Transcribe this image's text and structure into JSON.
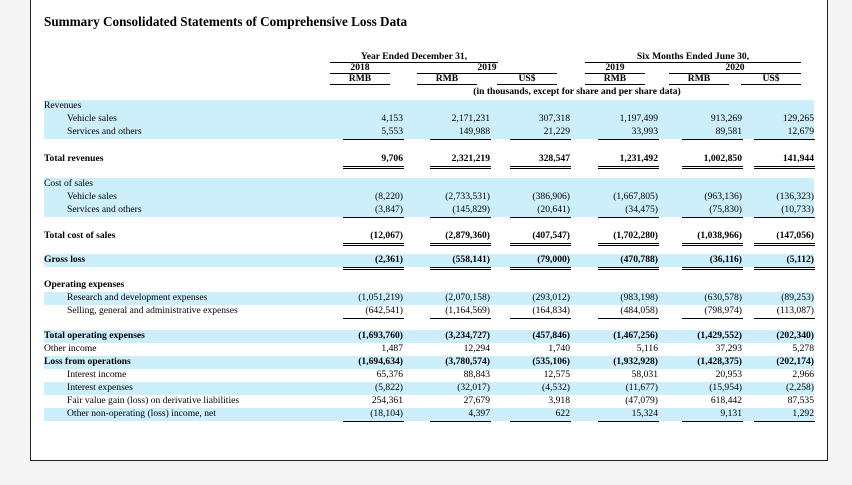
{
  "title": "Summary Consolidated Statements of Comprehensive Loss Data",
  "header": {
    "group1": "Year Ended December 31,",
    "group2": "Six Months Ended June 30,",
    "year2018": "2018",
    "year2019a": "2019",
    "year2019b": "2019",
    "year2020": "2020",
    "cur": [
      "RMB",
      "RMB",
      "US$",
      "RMB",
      "RMB",
      "US$"
    ],
    "note": "(in thousands, except for share and per share data)"
  },
  "rows": [
    {
      "label": "Revenues",
      "values": []
    },
    {
      "label": "Vehicle sales",
      "values": [
        "4,153",
        "2,171,231",
        "307,318",
        "1,197,499",
        "913,269",
        "129,265"
      ]
    },
    {
      "label": "Services and others",
      "values": [
        "5,553",
        "149,988",
        "21,229",
        "33,993",
        "89,581",
        "12,679"
      ]
    },
    {
      "label": "Total revenues",
      "values": [
        "9,706",
        "2,321,219",
        "328,547",
        "1,231,492",
        "1,002,850",
        "141,944"
      ]
    },
    {
      "label": "Cost of sales",
      "values": []
    },
    {
      "label": "Vehicle sales",
      "values": [
        "(8,220)",
        "(2,733,531)",
        "(386,906)",
        "(1,667,805)",
        "(963,136)",
        "(136,323)"
      ]
    },
    {
      "label": "Services and others",
      "values": [
        "(3,847)",
        "(145,829)",
        "(20,641)",
        "(34,475)",
        "(75,830)",
        "(10,733)"
      ]
    },
    {
      "label": "Total cost of sales",
      "values": [
        "(12,067)",
        "(2,879,360)",
        "(407,547)",
        "(1,702,280)",
        "(1,038,966)",
        "(147,056)"
      ]
    },
    {
      "label": "Gross loss",
      "values": [
        "(2,361)",
        "(558,141)",
        "(79,000)",
        "(470,788)",
        "(36,116)",
        "(5,112)"
      ]
    },
    {
      "label": "Operating expenses",
      "values": []
    },
    {
      "label": "Research and development expenses",
      "values": [
        "(1,051,219)",
        "(2,070,158)",
        "(293,012)",
        "(983,198)",
        "(630,578)",
        "(89,253)"
      ]
    },
    {
      "label": "Selling, general and administrative expenses",
      "values": [
        "(642,541)",
        "(1,164,569)",
        "(164,834)",
        "(484,058)",
        "(798,974)",
        "(113,087)"
      ]
    },
    {
      "label": "Total operating expenses",
      "values": [
        "(1,693,760)",
        "(3,234,727)",
        "(457,846)",
        "(1,467,256)",
        "(1,429,552)",
        "(202,340)"
      ]
    },
    {
      "label": "Other income",
      "values": [
        "1,487",
        "12,294",
        "1,740",
        "5,116",
        "37,293",
        "5,278"
      ]
    },
    {
      "label": "Loss from operations",
      "values": [
        "(1,694,634)",
        "(3,780,574)",
        "(535,106)",
        "(1,932,928)",
        "(1,428,375)",
        "(202,174)"
      ]
    },
    {
      "label": "Interest income",
      "values": [
        "65,376",
        "88,843",
        "12,575",
        "58,031",
        "20,953",
        "2,966"
      ]
    },
    {
      "label": "Interest expenses",
      "values": [
        "(5,822)",
        "(32,017)",
        "(4,532)",
        "(11,677)",
        "(15,954)",
        "(2,258)"
      ]
    },
    {
      "label": "Fair value gain (loss) on derivative liabilities",
      "values": [
        "254,361",
        "27,679",
        "3,918",
        "(47,079)",
        "618,442",
        "87,535"
      ]
    },
    {
      "label": "Other non-operating (loss) income, net",
      "values": [
        "(18,104)",
        "4,397",
        "622",
        "15,324",
        "9,131",
        "1,292"
      ]
    }
  ],
  "colors": {
    "band": "#cdeefb"
  }
}
